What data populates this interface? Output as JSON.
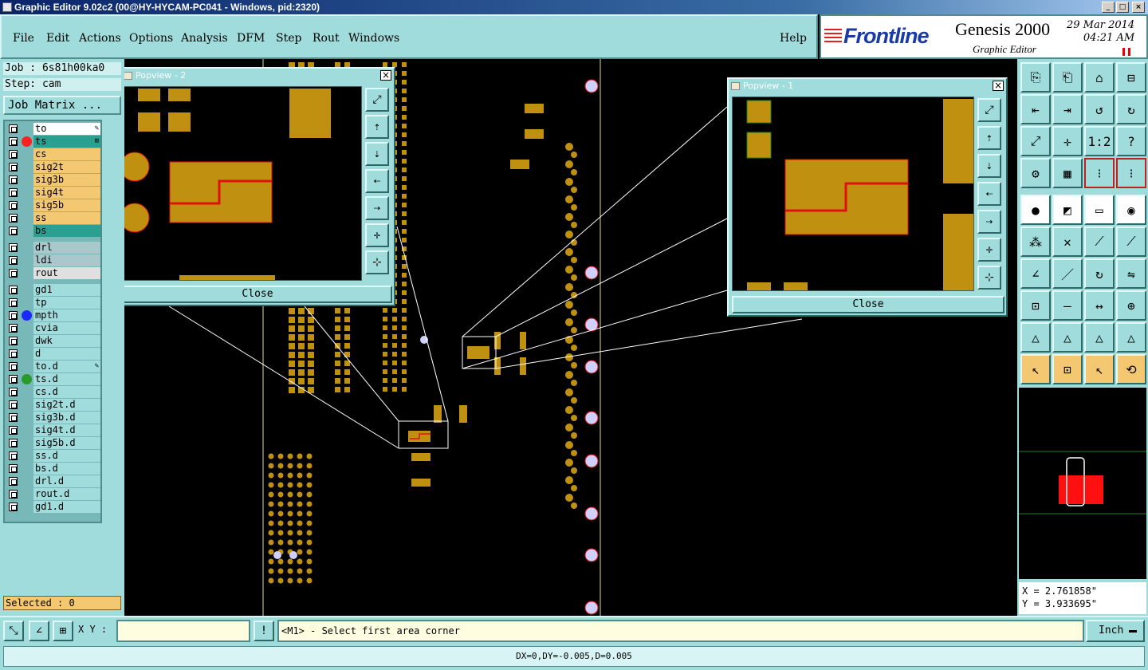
{
  "window": {
    "title": "Graphic Editor 9.02c2 (00@HY-HYCAM-PC041 - Windows, pid:2320)"
  },
  "menu": [
    {
      "label": "File"
    },
    {
      "label": "Edit"
    },
    {
      "label": "Actions"
    },
    {
      "label": "Options"
    },
    {
      "label": "Analysis"
    },
    {
      "label": "DFM"
    },
    {
      "label": "Step"
    },
    {
      "label": "Rout"
    },
    {
      "label": "Windows"
    }
  ],
  "help_label": "Help",
  "brand": {
    "company": "Frontline",
    "product": "Genesis 2000",
    "subtitle": "Graphic Editor",
    "date": "29 Mar 2014",
    "time": "04:21 AM"
  },
  "job": {
    "job_label": "Job : 6s81h00ka0",
    "step_label": "Step: cam",
    "matrix_button": "Job Matrix ..."
  },
  "layers": [
    {
      "name": "to",
      "bg": "#ffffff",
      "dot": "",
      "mark": "pencil"
    },
    {
      "name": "ts",
      "bg": "#2aa090",
      "dot": "#ff2020",
      "mark": "grid",
      "active": true
    },
    {
      "name": "cs",
      "bg": "#f4c870",
      "dot": ""
    },
    {
      "name": "sig2t",
      "bg": "#f4c870",
      "dot": ""
    },
    {
      "name": "sig3b",
      "bg": "#f4c870",
      "dot": ""
    },
    {
      "name": "sig4t",
      "bg": "#f4c870",
      "dot": ""
    },
    {
      "name": "sig5b",
      "bg": "#f4c870",
      "dot": ""
    },
    {
      "name": "ss",
      "bg": "#f4c870",
      "dot": ""
    },
    {
      "name": "bs",
      "bg": "#2aa090",
      "dot": ""
    },
    {
      "name": "drl",
      "bg": "#a8c8cc",
      "dot": "",
      "gap": true
    },
    {
      "name": "ldi",
      "bg": "#a8c8cc",
      "dot": ""
    },
    {
      "name": "rout",
      "bg": "#e0e0e0",
      "dot": ""
    },
    {
      "name": "gd1",
      "bg": "#a0dcdc",
      "dot": "",
      "gap": true
    },
    {
      "name": "tp",
      "bg": "#a0dcdc",
      "dot": ""
    },
    {
      "name": "mpth",
      "bg": "#a0dcdc",
      "dot": "#1a2aff"
    },
    {
      "name": "cvia",
      "bg": "#a0dcdc",
      "dot": ""
    },
    {
      "name": "dwk",
      "bg": "#a0dcdc",
      "dot": ""
    },
    {
      "name": "d",
      "bg": "#a0dcdc",
      "dot": ""
    },
    {
      "name": "to.d",
      "bg": "#a0dcdc",
      "dot": "",
      "mark": "pencil"
    },
    {
      "name": "ts.d",
      "bg": "#a0dcdc",
      "dot": "#2a9a2a"
    },
    {
      "name": "cs.d",
      "bg": "#a0dcdc",
      "dot": ""
    },
    {
      "name": "sig2t.d",
      "bg": "#a0dcdc",
      "dot": ""
    },
    {
      "name": "sig3b.d",
      "bg": "#a0dcdc",
      "dot": ""
    },
    {
      "name": "sig4t.d",
      "bg": "#a0dcdc",
      "dot": ""
    },
    {
      "name": "sig5b.d",
      "bg": "#a0dcdc",
      "dot": ""
    },
    {
      "name": "ss.d",
      "bg": "#a0dcdc",
      "dot": ""
    },
    {
      "name": "bs.d",
      "bg": "#a0dcdc",
      "dot": ""
    },
    {
      "name": "drl.d",
      "bg": "#a0dcdc",
      "dot": ""
    },
    {
      "name": "rout.d",
      "bg": "#a0dcdc",
      "dot": ""
    },
    {
      "name": "gd1.d",
      "bg": "#a0dcdc",
      "dot": ""
    }
  ],
  "selected_label": "Selected : 0",
  "popview2": {
    "title": "Popview - 2",
    "close": "Close"
  },
  "popview1": {
    "title": "Popview - 1",
    "close": "Close"
  },
  "popview_tools": [
    "zoom-fit-icon",
    "up-arrow-icon",
    "down-arrow-icon",
    "left-arrow-icon",
    "right-arrow-icon",
    "zoom-in-icon",
    "zoom-out-icon"
  ],
  "coords": {
    "x": "X = 2.761858\"",
    "y": "Y = 3.933695\""
  },
  "xy_label": "X Y :",
  "prompt": "<M1> - Select first area corner",
  "unit": "Inch",
  "status": "DX=0,DY=-0.005,D=0.005",
  "colors": {
    "pad": "#c09010",
    "trace": "#e01010",
    "panel": "#a0dcdc",
    "layer_signal": "#f4c870",
    "layer_mask": "#2aa090"
  }
}
